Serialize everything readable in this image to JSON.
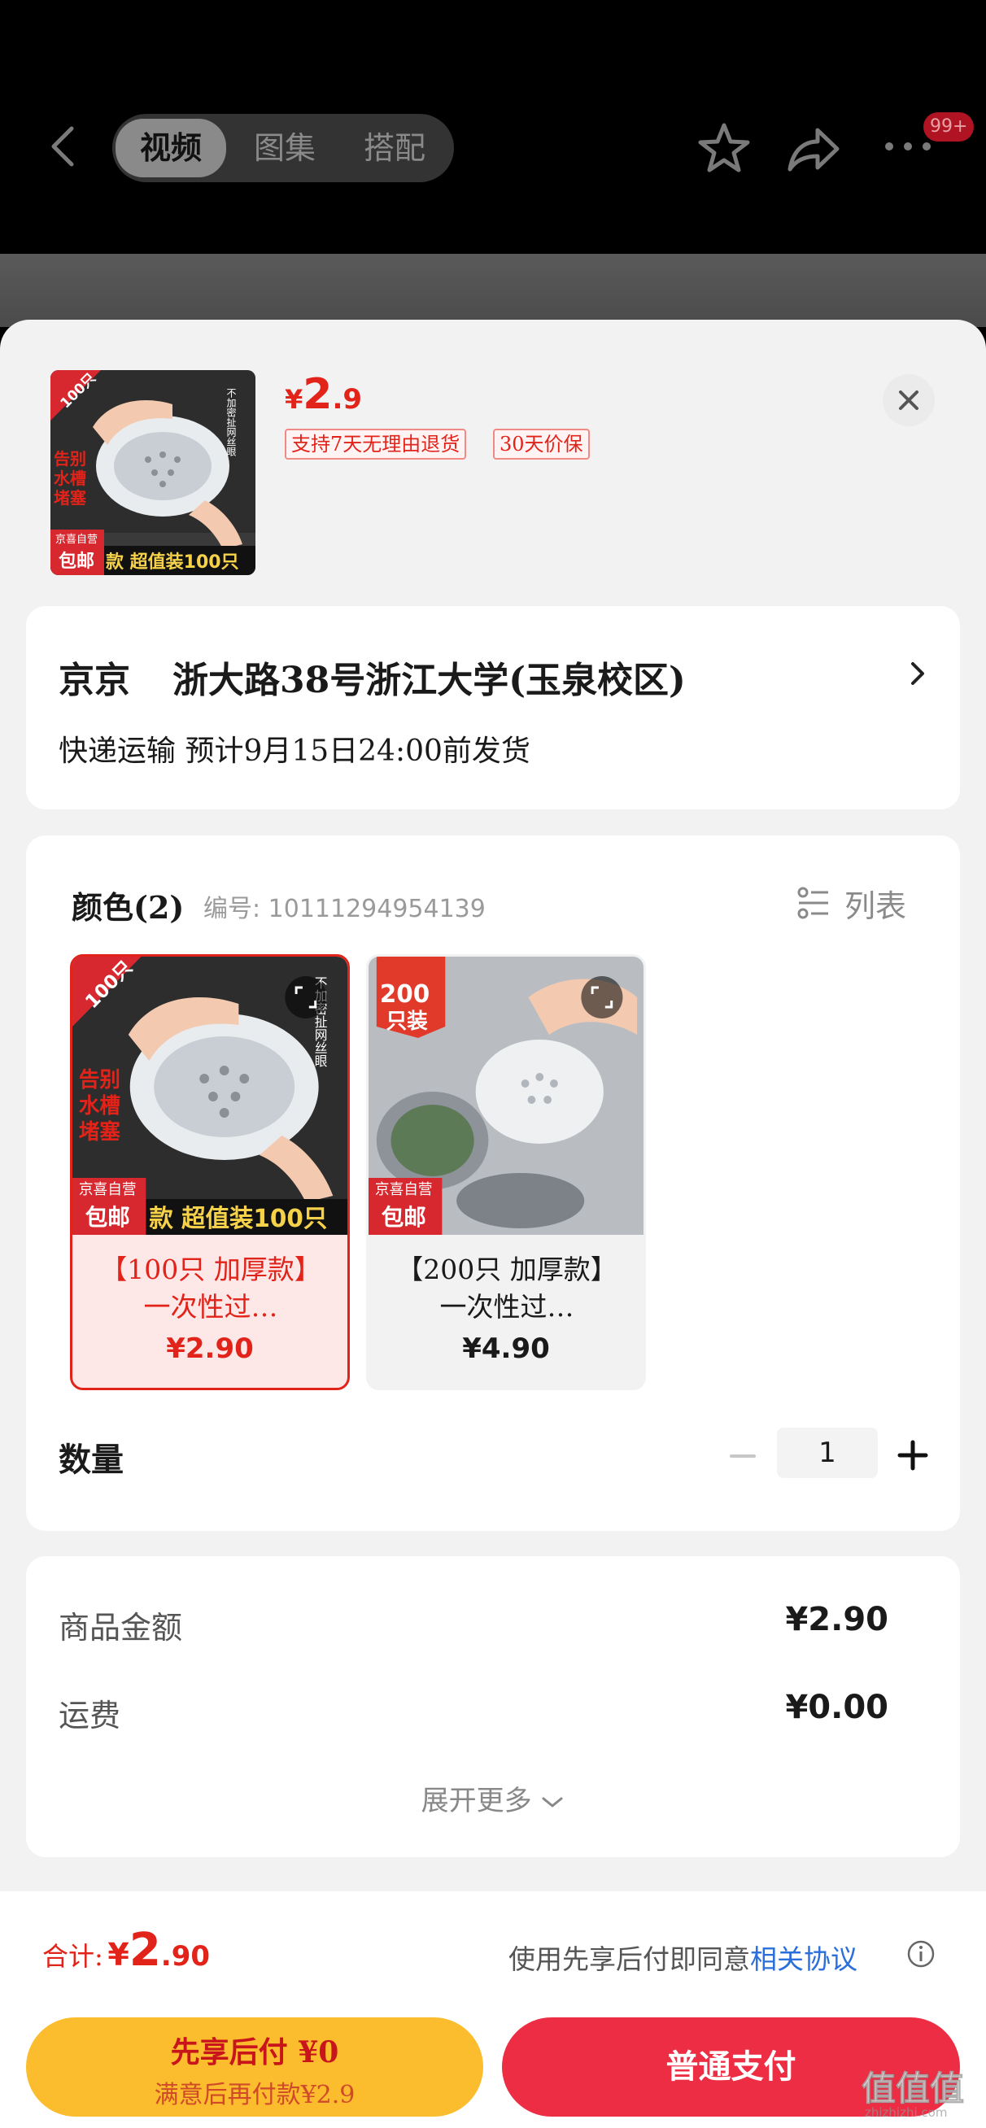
{
  "nav": {
    "tabs": [
      {
        "label": "视频",
        "active": true
      },
      {
        "label": "图集",
        "active": false
      },
      {
        "label": "搭配",
        "active": false
      }
    ],
    "more_badge": "99+"
  },
  "sheet": {
    "product": {
      "price_symbol": "¥",
      "price_int": "2",
      "price_dec": ".9",
      "tags": [
        "支持7天无理由退货",
        "30天价保"
      ],
      "thumb": {
        "corner_badge": "100只",
        "side_text": "不加密扯网丝眼",
        "feature_lines": [
          "告别",
          "水槽",
          "堵塞"
        ],
        "store_badge": "京喜自营",
        "ship_badge": "包邮",
        "strip_text": "款 超值装100只"
      }
    },
    "address": {
      "name": "京京",
      "detail": "浙大路38号浙江大学(玉泉校区)",
      "shipping": "快递运输  预计9月15日24:00前发货"
    },
    "spec": {
      "title": "颜色(2)",
      "sku": "编号: 10111294954139",
      "list_toggle": "列表",
      "options": [
        {
          "name": "【100只 加厚款】一次性过…",
          "price": "¥2.90",
          "selected": true,
          "corner_badge": "100只",
          "side_text": "不加密扯网丝眼",
          "feature_lines": [
            "告别",
            "水槽",
            "堵塞"
          ],
          "store_badge": "京喜自营",
          "ship_badge": "包邮",
          "strip_text": "款 超值装100只"
        },
        {
          "name": "【200只 加厚款】一次性过…",
          "price": "¥4.90",
          "selected": false,
          "corner_badge": "200",
          "corner_badge_sub": "只装",
          "store_badge": "京喜自营",
          "ship_badge": "包邮"
        }
      ],
      "quantity_label": "数量",
      "quantity": "1"
    },
    "amounts": {
      "goods_label": "商品金额",
      "goods_value": "¥2.90",
      "shipping_label": "运费",
      "shipping_value": "¥0.00",
      "expand": "展开更多"
    }
  },
  "footer": {
    "total_label": "合计:",
    "total_symbol": "¥",
    "total_int": "2",
    "total_dec": ".90",
    "agree_text": "使用先享后付即同意",
    "agree_link": "相关协议",
    "btn_later_title": "先享后付 ¥0",
    "btn_later_sub": "满意后再付款¥2.9",
    "btn_pay": "普通支付"
  },
  "watermark": "值值值",
  "watermark_sub": "zhizhizhi.com",
  "colors": {
    "accent_red": "#e2231a",
    "pay_button": "#ed2d44",
    "later_button": "#fbbd2d",
    "link_blue": "#2a6fdb"
  }
}
